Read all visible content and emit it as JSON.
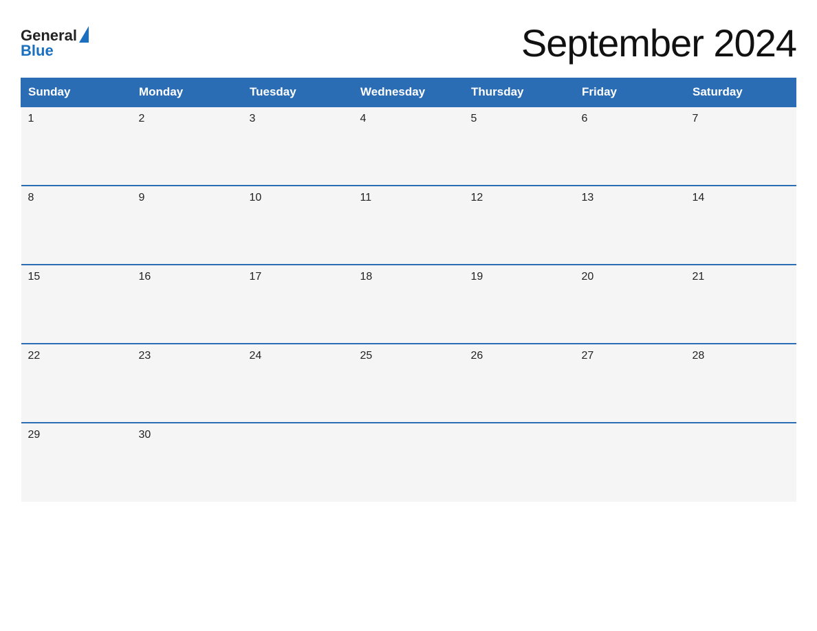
{
  "header": {
    "logo": {
      "general": "General",
      "blue": "Blue",
      "aria": "GeneralBlue logo"
    },
    "title": "September 2024"
  },
  "calendar": {
    "days_of_week": [
      "Sunday",
      "Monday",
      "Tuesday",
      "Wednesday",
      "Thursday",
      "Friday",
      "Saturday"
    ],
    "weeks": [
      [
        {
          "day": "1",
          "empty": false
        },
        {
          "day": "2",
          "empty": false
        },
        {
          "day": "3",
          "empty": false
        },
        {
          "day": "4",
          "empty": false
        },
        {
          "day": "5",
          "empty": false
        },
        {
          "day": "6",
          "empty": false
        },
        {
          "day": "7",
          "empty": false
        }
      ],
      [
        {
          "day": "8",
          "empty": false
        },
        {
          "day": "9",
          "empty": false
        },
        {
          "day": "10",
          "empty": false
        },
        {
          "day": "11",
          "empty": false
        },
        {
          "day": "12",
          "empty": false
        },
        {
          "day": "13",
          "empty": false
        },
        {
          "day": "14",
          "empty": false
        }
      ],
      [
        {
          "day": "15",
          "empty": false
        },
        {
          "day": "16",
          "empty": false
        },
        {
          "day": "17",
          "empty": false
        },
        {
          "day": "18",
          "empty": false
        },
        {
          "day": "19",
          "empty": false
        },
        {
          "day": "20",
          "empty": false
        },
        {
          "day": "21",
          "empty": false
        }
      ],
      [
        {
          "day": "22",
          "empty": false
        },
        {
          "day": "23",
          "empty": false
        },
        {
          "day": "24",
          "empty": false
        },
        {
          "day": "25",
          "empty": false
        },
        {
          "day": "26",
          "empty": false
        },
        {
          "day": "27",
          "empty": false
        },
        {
          "day": "28",
          "empty": false
        }
      ],
      [
        {
          "day": "29",
          "empty": false
        },
        {
          "day": "30",
          "empty": false
        },
        {
          "day": "",
          "empty": true
        },
        {
          "day": "",
          "empty": true
        },
        {
          "day": "",
          "empty": true
        },
        {
          "day": "",
          "empty": true
        },
        {
          "day": "",
          "empty": true
        }
      ]
    ]
  }
}
